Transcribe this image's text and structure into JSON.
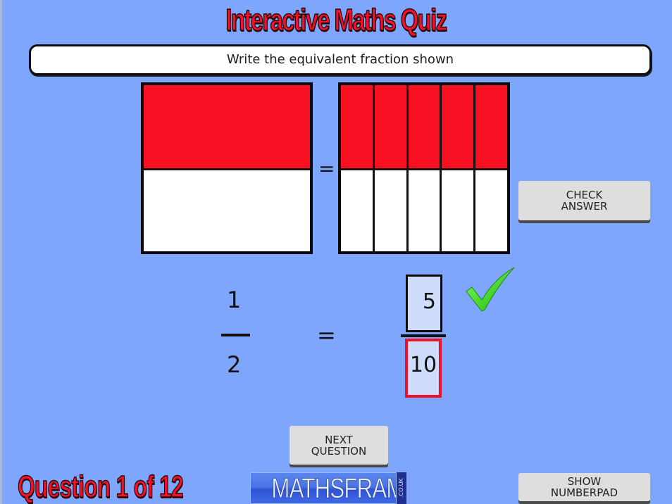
{
  "header": {
    "title": "Interactive Maths Quiz"
  },
  "question": {
    "instruction": "Write the equivalent fraction shown"
  },
  "diagram": {
    "left_bar": {
      "parts": 2,
      "shaded": 1
    },
    "right_bar": {
      "parts": 10,
      "shaded": 5,
      "columns": 5,
      "rows": 2
    },
    "equals": "=",
    "shade_color": "#f80f22"
  },
  "equation": {
    "given": {
      "numerator": "1",
      "denominator": "2"
    },
    "equals": "=",
    "answer": {
      "numerator": "5",
      "denominator": "10"
    },
    "result": "correct",
    "result_icon": "check-mark-icon"
  },
  "buttons": {
    "check_answer_line1": "CHECK",
    "check_answer_line2": "ANSWER",
    "next_question_line1": "NEXT",
    "next_question_line2": "QUESTION",
    "show_numberpad_line1": "SHOW",
    "show_numberpad_line2": "NUMBERPAD"
  },
  "footer": {
    "question_counter": "Question 1 of 12",
    "logo_text": "MATHSFRAME",
    "logo_tld": ".CO.UK"
  },
  "colors": {
    "background": "#7fa6fd",
    "title_red": "#f8102a",
    "answer_box_fill": "#d0dcfb",
    "active_box_border": "#f1102a",
    "check_green": "#35e01c"
  }
}
